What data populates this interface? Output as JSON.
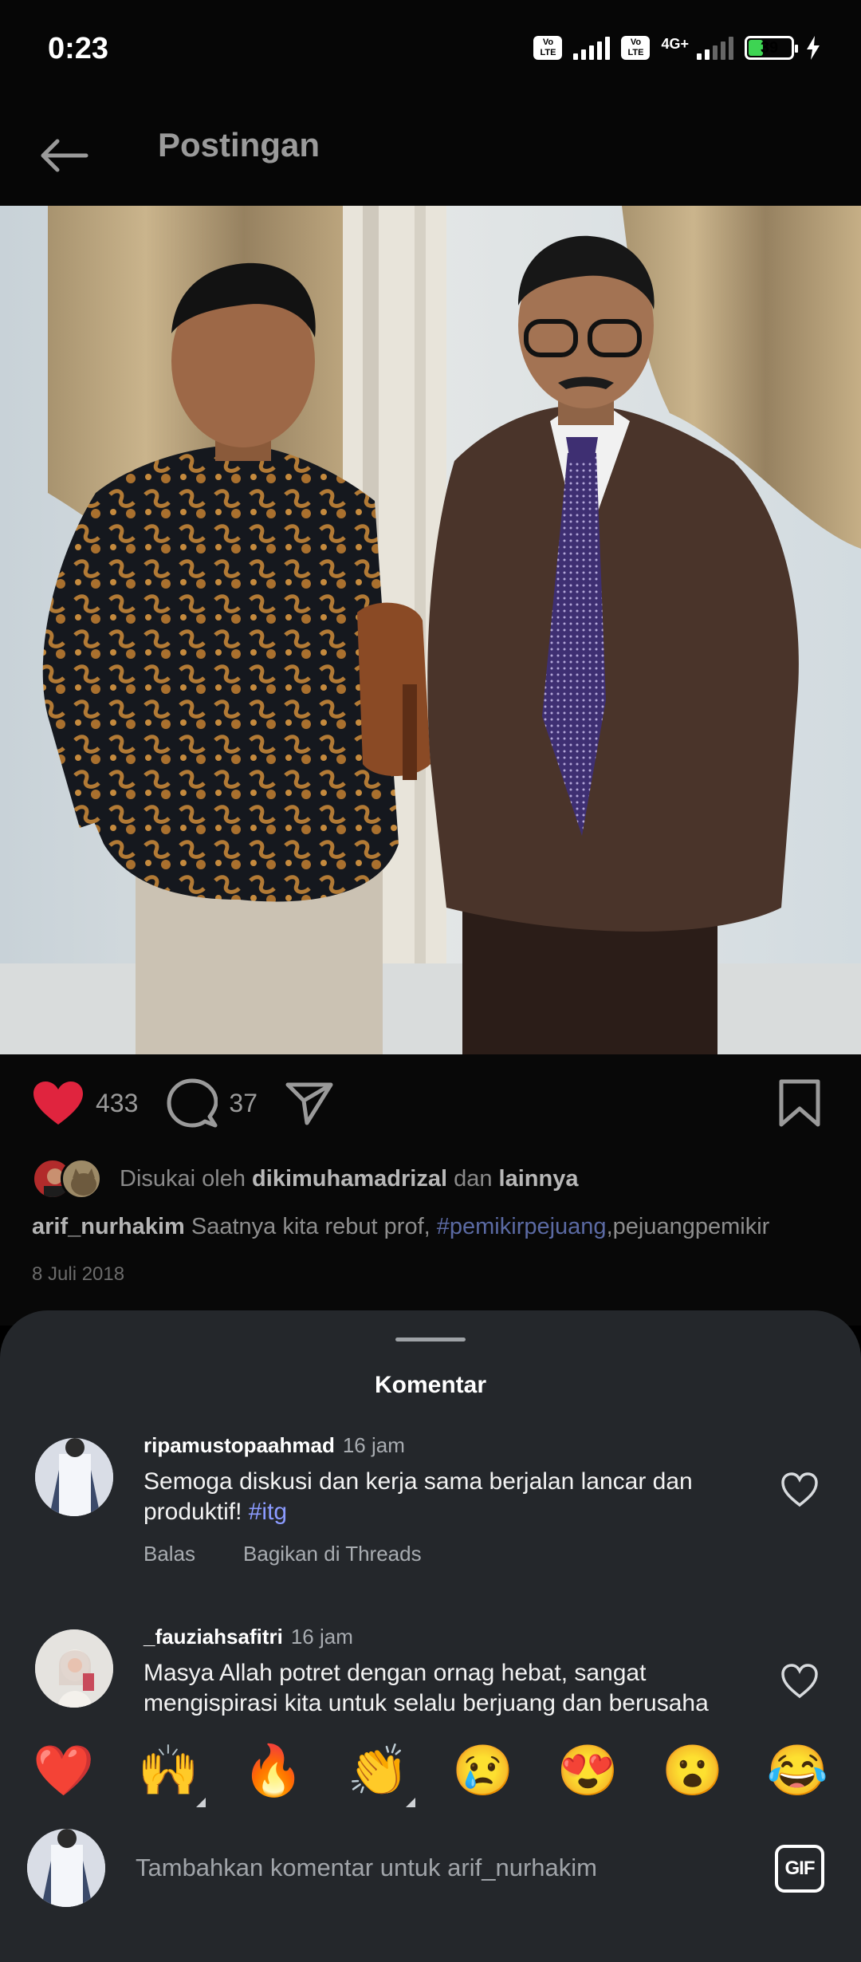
{
  "status_bar": {
    "time": "0:23",
    "volte_label": "Vo LTE",
    "network_label": "4G+",
    "battery_level": "39",
    "battery_percent": 39,
    "battery_color": "#3ed453"
  },
  "header": {
    "back_icon": "arrow-left-icon",
    "title": "Postingan"
  },
  "post": {
    "image_description_icon": "photo",
    "likes_count": "433",
    "comments_count": "37",
    "like_color": "#e0243e",
    "liked_by_prefix": "Disukai oleh",
    "liked_by_user": "dikimuhamadrizal",
    "liked_by_joiner": "dan",
    "liked_by_others": "lainnya",
    "author": "arif_nurhakim",
    "caption_text": "Saatnya kita rebut prof,",
    "caption_hashtag": "#pemikirpejuang",
    "caption_tail": ",pejuangpemikir",
    "date": "8 Juli 2018"
  },
  "comments_sheet": {
    "title": "Komentar",
    "comments": [
      {
        "username": "ripamustopaahmad",
        "time": "16 jam",
        "text": "Semoga diskusi dan kerja sama berjalan lancar dan produktif!",
        "hashtag": "#itg",
        "reply_label": "Balas",
        "share_label": "Bagikan di Threads"
      },
      {
        "username": "_fauziahsafitri",
        "time": "16 jam",
        "text": "Masya Allah potret dengan ornag hebat, sangat mengispirasi kita untuk selalu berjuang dan berusaha"
      }
    ],
    "emojis": [
      {
        "char": "❤️",
        "name": "heart"
      },
      {
        "char": "🙌",
        "name": "raising-hands"
      },
      {
        "char": "🔥",
        "name": "fire"
      },
      {
        "char": "👏",
        "name": "clapping-hands"
      },
      {
        "char": "😢",
        "name": "crying-face"
      },
      {
        "char": "😍",
        "name": "heart-eyes"
      },
      {
        "char": "😮",
        "name": "surprised-face"
      },
      {
        "char": "😂",
        "name": "tears-of-joy"
      }
    ],
    "input_placeholder": "Tambahkan komentar untuk arif_nurhakim",
    "gif_label": "GIF"
  }
}
